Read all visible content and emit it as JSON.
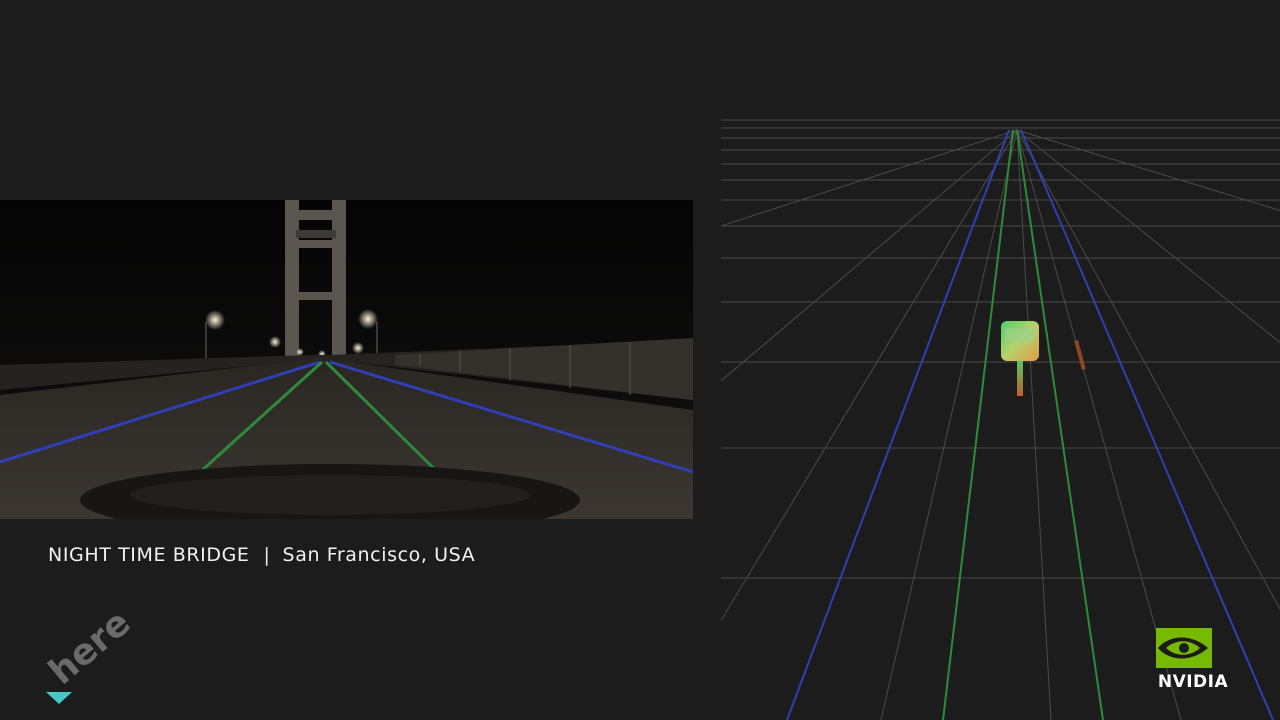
{
  "caption": {
    "title": "NIGHT TIME BRIDGE",
    "separator": "|",
    "location": "San Francisco, USA"
  },
  "logos": {
    "left": {
      "text": "here",
      "icon": "here-logo-icon"
    },
    "right": {
      "text": "NVIDIA",
      "icon": "nvidia-eye-icon"
    }
  },
  "colors": {
    "background": "#1c1c1c",
    "lane_outer": "#2f3fb4",
    "lane_inner": "#2e8a3a",
    "grid": "#4a4a4a",
    "nvidia_green": "#76b900",
    "here_accent": "#48c9c9"
  }
}
